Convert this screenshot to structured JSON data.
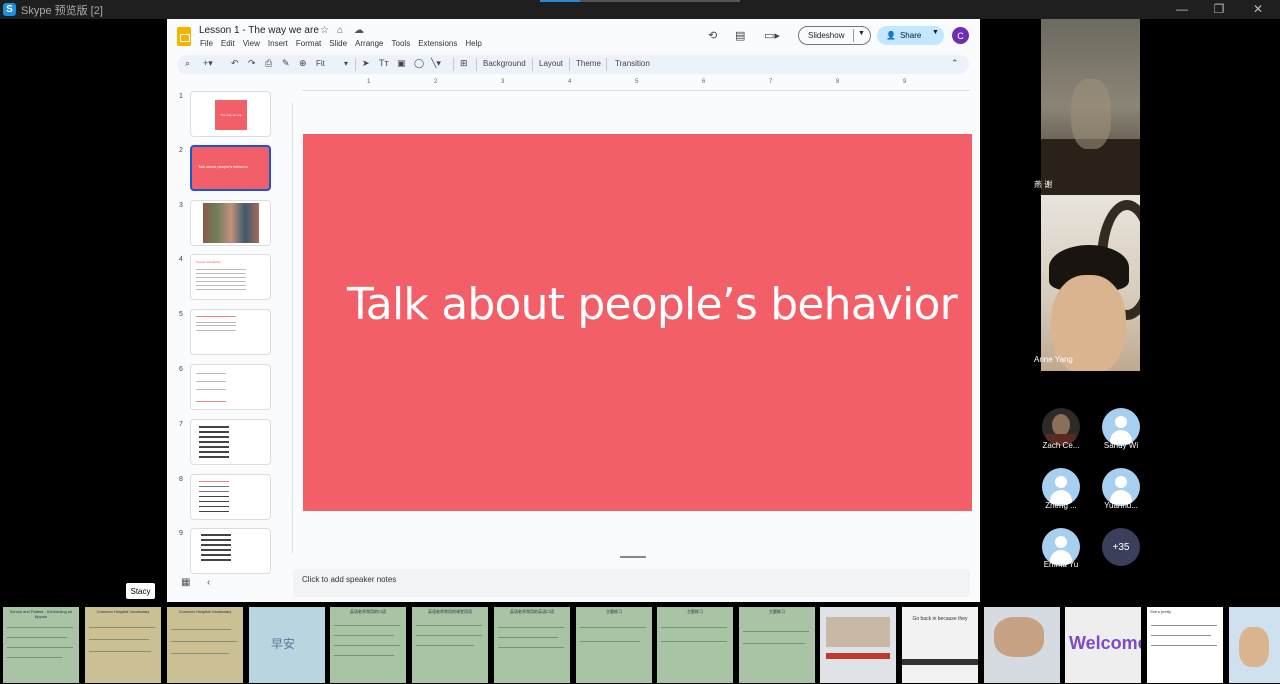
{
  "window": {
    "title": "Skype 预览版 [2]",
    "app_icon_letter": "S"
  },
  "doc": {
    "title": "Lesson 1 - The way we are",
    "menu": [
      "File",
      "Edit",
      "View",
      "Insert",
      "Format",
      "Slide",
      "Arrange",
      "Tools",
      "Extensions",
      "Help"
    ],
    "slideshow_label": "Slideshow",
    "share_label": "Share",
    "user_initial": "C"
  },
  "toolbar": {
    "zoom": "Fit",
    "background_label": "Background",
    "layout_label": "Layout",
    "theme_label": "Theme",
    "transition_label": "Transition"
  },
  "ruler": {
    "ticks": [
      "1",
      "2",
      "3",
      "4",
      "5",
      "6",
      "7",
      "8",
      "9"
    ]
  },
  "slides": {
    "numbers": [
      "1",
      "2",
      "3",
      "4",
      "5",
      "6",
      "7",
      "8",
      "9"
    ],
    "thumb1_text": "The way we are",
    "thumb2_text": "Talk about people's behavior",
    "thumb4_text": "People Vocabulary"
  },
  "current_slide": {
    "text": "Talk about people’s behavior",
    "bg_color": "#f35f68"
  },
  "notes": {
    "placeholder": "Click to add speaker notes"
  },
  "presenter_tag": "Stacy",
  "participants": {
    "video": [
      {
        "name": "燕 谢"
      },
      {
        "name": "Anne Yang"
      }
    ],
    "tiles": [
      {
        "name": "Zach Ce..."
      },
      {
        "name": "Sandy Wi"
      },
      {
        "name": "Zheng ..."
      },
      {
        "name": "Yuanhu..."
      },
      {
        "name": "Emma Yu"
      }
    ],
    "more_count": "+35"
  },
  "strip": {
    "thumb_captions": [
      "School and Patient - Scheduling an Appoin",
      "Common Hospital Vocabulary",
      "Common Hospital Vocabulary",
      "早安",
      "英语老师常用的口语",
      "英语老师常用的课堂用语",
      "英语老师常用的英语口语",
      "主题练习",
      "主题练习",
      "主题练习",
      "",
      "Go back in because they",
      "",
      "Welcome",
      "She's pretty",
      ""
    ]
  }
}
